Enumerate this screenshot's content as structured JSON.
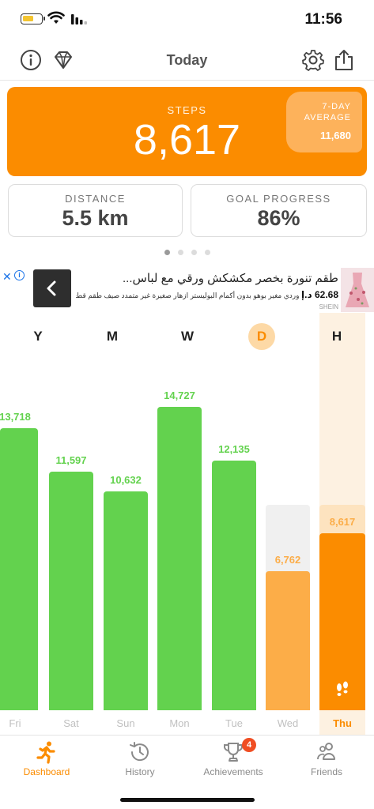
{
  "status_bar": {
    "time": "11:56",
    "battery_level": 0.6
  },
  "nav": {
    "title": "Today",
    "left_icons": [
      "info-icon",
      "diamond-icon"
    ],
    "right_icons": [
      "gear-icon",
      "share-icon"
    ]
  },
  "steps_card": {
    "label": "STEPS",
    "value": "8,617",
    "average_label": "7-DAY\nAVERAGE",
    "average_value": "11,680",
    "color": "#fb8c00"
  },
  "stats": {
    "distance_label": "DISTANCE",
    "distance_value": "5.5 km",
    "goal_label": "GOAL PROGRESS",
    "goal_value": "86%"
  },
  "pager": {
    "pages": 4,
    "active": 0
  },
  "ad": {
    "title": "طقم تنورة بخصر مكشكش ورقي مع لباس...",
    "price": "62.68 د.إ",
    "description": "وردي مغير بوهو بدون أكمام البوليستر ازهار صغيرة غير متمدد صيف طقم قطعتين, size...",
    "brand": "SHEIN"
  },
  "chart": {
    "day_letters": [
      "Y",
      "M",
      "W",
      "D",
      "H"
    ],
    "today_letter_index": 3,
    "highlight_letter_index": 4,
    "days": [
      {
        "name": "Fri",
        "value": 13718,
        "label": "13,718",
        "state": "complete"
      },
      {
        "name": "Sat",
        "value": 11597,
        "label": "11,597",
        "state": "complete"
      },
      {
        "name": "Sun",
        "value": 10632,
        "label": "10,632",
        "state": "complete"
      },
      {
        "name": "Mon",
        "value": 14727,
        "label": "14,727",
        "state": "complete"
      },
      {
        "name": "Tue",
        "value": 12135,
        "label": "12,135",
        "state": "complete"
      },
      {
        "name": "Wed",
        "value": 6762,
        "label": "6,762",
        "state": "partial",
        "goal": 10000
      },
      {
        "name": "Thu",
        "value": 8617,
        "label": "8,617",
        "state": "today",
        "goal": 10000
      }
    ],
    "colors": {
      "complete": "#63d24e",
      "partial": "#fcad48",
      "today": "#fb8c00",
      "goal_track": "#f0f0f0",
      "today_track": "#fde3bf"
    }
  },
  "tabs": [
    {
      "label": "Dashboard",
      "icon": "runner-icon",
      "active": true
    },
    {
      "label": "History",
      "icon": "history-icon",
      "active": false
    },
    {
      "label": "Achievements",
      "icon": "trophy-icon",
      "active": false,
      "badge": "4"
    },
    {
      "label": "Friends",
      "icon": "friends-icon",
      "active": false
    }
  ]
}
